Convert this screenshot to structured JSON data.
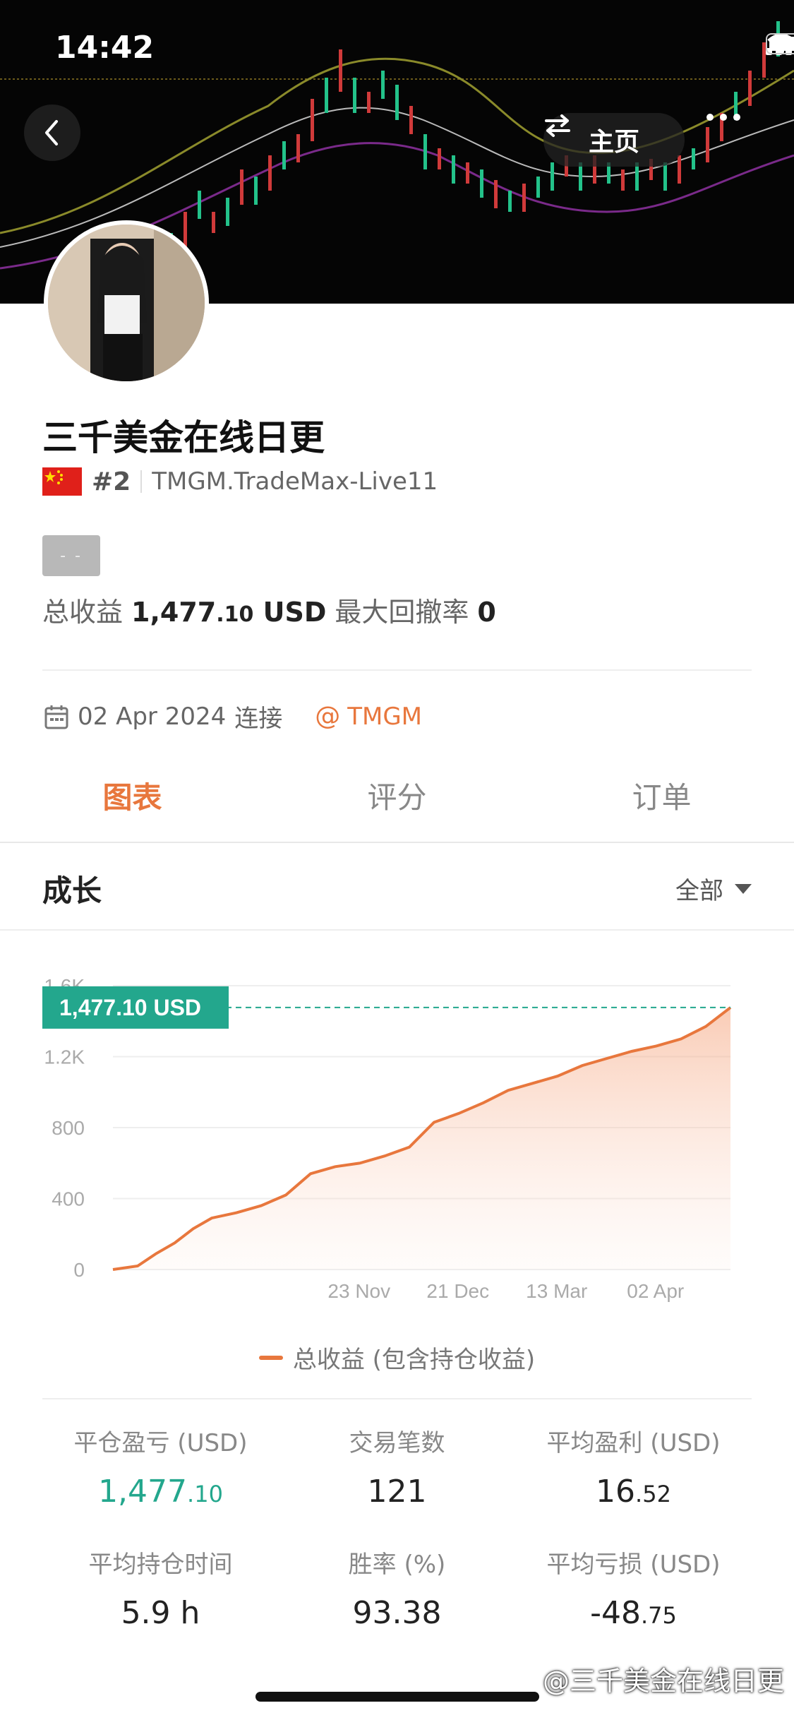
{
  "status_bar": {
    "time": "14:42"
  },
  "header": {
    "home_label": "主页"
  },
  "profile": {
    "name": "三千美金在线日更",
    "rank": "#2",
    "account": "TMGM.TradeMax-Live11",
    "tag": "- -",
    "total_return_label": "总收益",
    "total_return_int": "1,477",
    "total_return_dec": ".10",
    "total_return_unit": "USD",
    "max_drawdown_label": "最大回撤率",
    "max_drawdown_value": "0",
    "connect_date": "02 Apr 2024",
    "connect_label": "连接",
    "broker": "TMGM"
  },
  "tabs": [
    {
      "label": "图表",
      "active": true
    },
    {
      "label": "评分",
      "active": false
    },
    {
      "label": "订单",
      "active": false
    }
  ],
  "section": {
    "title": "成长",
    "filter": "全部"
  },
  "chart_data": {
    "type": "area",
    "x_tick_labels": [
      "23 Nov",
      "21 Dec",
      "13 Mar",
      "02 Apr"
    ],
    "y_tick_labels": [
      "0",
      "400",
      "800",
      "1.2K",
      "1.6K"
    ],
    "ylim": [
      0,
      1600
    ],
    "grid": true,
    "current_value_label": "1,477.10 USD",
    "legend": "总收益 (包含持仓收益)",
    "series": [
      {
        "name": "总收益 (包含持仓收益)",
        "color": "#e8773d",
        "x": [
          0,
          4,
          7,
          10,
          13,
          16,
          20,
          24,
          28,
          32,
          36,
          40,
          44,
          48,
          52,
          56,
          60,
          64,
          68,
          72,
          76,
          80,
          84,
          88,
          92,
          96,
          100
        ],
        "values": [
          0,
          20,
          90,
          150,
          230,
          290,
          320,
          360,
          420,
          540,
          580,
          600,
          640,
          690,
          830,
          880,
          940,
          1010,
          1050,
          1090,
          1150,
          1190,
          1230,
          1260,
          1300,
          1370,
          1477
        ]
      }
    ]
  },
  "stats": [
    {
      "label": "平仓盈亏 (USD)",
      "int": "1,477",
      "dec": ".10",
      "color": "green"
    },
    {
      "label": "交易笔数",
      "int": "121",
      "dec": ""
    },
    {
      "label": "平均盈利 (USD)",
      "int": "16",
      "dec": ".52"
    },
    {
      "label": "平均持仓时间",
      "int": "5.9 h",
      "dec": ""
    },
    {
      "label": "胜率 (%)",
      "int": "93.38",
      "dec": ""
    },
    {
      "label": "平均亏损 (USD)",
      "int": "-48",
      "dec": ".75"
    }
  ],
  "watermark": "@三千美金在线日更"
}
